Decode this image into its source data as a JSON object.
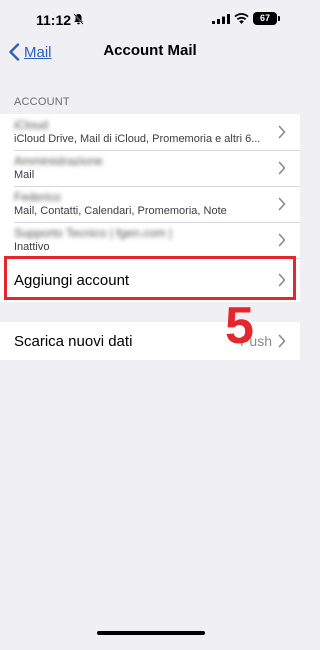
{
  "status_bar": {
    "time": "11:12",
    "battery": "67",
    "icons": [
      "bell-slash-icon",
      "signal-icon",
      "wifi-icon",
      "battery-icon"
    ]
  },
  "nav": {
    "back_label": "Mail",
    "title": "Account Mail"
  },
  "accounts": {
    "section_header": "ACCOUNT",
    "items": [
      {
        "title": "iCloud",
        "subtitle": "iCloud Drive, Mail di iCloud, Promemoria e altri 6..."
      },
      {
        "title": "Amministrazione",
        "subtitle": "Mail"
      },
      {
        "title": "Federico",
        "subtitle": "Mail, Contatti, Calendari, Promemoria, Note"
      },
      {
        "title": "Supporto Tecnico | fgen.com |",
        "subtitle": "Inattivo"
      }
    ],
    "add_account_label": "Aggiungi account"
  },
  "fetch": {
    "label": "Scarica nuovi dati",
    "value": "Push"
  },
  "annotation": {
    "step_number": "5",
    "color": "#e3272d"
  },
  "colors": {
    "accent": "#2c5fbf",
    "background": "#f0eff4"
  }
}
